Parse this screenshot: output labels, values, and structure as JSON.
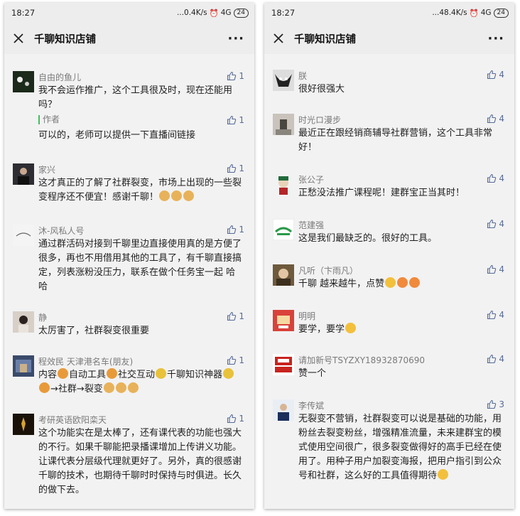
{
  "left": {
    "status": {
      "time": "18:27",
      "speed": "...0.4K/s",
      "signal": "4G",
      "battery": "24"
    },
    "header": {
      "title": "千聊知识店铺",
      "more": "···"
    },
    "comments": [
      {
        "name": "自由的鱼儿",
        "likes": "1",
        "text": "我不会运作推广，这个工具很及时，现在还能用吗？",
        "reply": {
          "name": "作者",
          "likes": "1",
          "text": "可以的，老师可以提供一下直播间链接"
        }
      },
      {
        "name": "家兴",
        "likes": "1",
        "text": "这才真正的了解了社群裂变，市场上出现的一些裂变程序还不便宜！感谢千聊！"
      },
      {
        "name": "沐-风私人号",
        "likes": "1",
        "text": "通过群活码对接到千聊里边直接使用真的是方便了很多，再也不用借用其他的工具了，有千聊直接搞定，列表涨粉没压力，联系在做个任务宝一起 哈哈"
      },
      {
        "name": "静",
        "likes": "1",
        "text": "太厉害了，社群裂变很重要"
      },
      {
        "name": "程效民 天津港名车(朋友)",
        "likes": "1",
        "text_a": "内容",
        "text_b": "自动工具",
        "text_c": "社交互动",
        "text_d": "千聊知识神器",
        "text_e": "→社群→裂变"
      },
      {
        "name": "考研英语欧阳栾天",
        "likes": "1",
        "text": "这个功能实在是太棒了，还有课代表的功能也强大的不行。如果千聊能把录播课增加上传讲义功能。让课代表分层级代理就更好了。另外，真的很感谢千聊的技术，也期待千聊时时保持与时俱进。长久的做下去。"
      }
    ]
  },
  "right": {
    "status": {
      "time": "18:27",
      "speed": "...48.4K/s",
      "signal": "4G",
      "battery": "24"
    },
    "header": {
      "title": "千聊知识店铺",
      "more": "···"
    },
    "comments": [
      {
        "name": "朕",
        "likes": "4",
        "text": "很好很强大"
      },
      {
        "name": "时光ロ漫步",
        "likes": "4",
        "text": "最近正在跟经销商辅导社群营销，这个工具非常好！"
      },
      {
        "name": "张公子",
        "likes": "4",
        "text": "正愁没法推广课程呢！建群宝正当其时！"
      },
      {
        "name": "范建强",
        "likes": "4",
        "text": "这是我们最缺乏的。很好的工具。"
      },
      {
        "name": "凡听（卞雨凡）",
        "likes": "4",
        "text": "千聊 越来越牛，点赞"
      },
      {
        "name": "明明",
        "likes": "4",
        "text": "要学，要学"
      },
      {
        "name": "请加新号TSYZXY18932870690",
        "likes": "4",
        "text": "赞一个"
      },
      {
        "name": "李传斌",
        "likes": "3",
        "text": "无裂变不营销，社群裂变可以说是基础的功能，用粉丝去裂变粉丝，增强精准流量，未来建群宝的模式使用空间很广，很多裂变做得好的高手已经在使用了。用种子用户加裂变海报，把用户指引到公众号和社群，这么好的工具值得期待"
      }
    ]
  }
}
